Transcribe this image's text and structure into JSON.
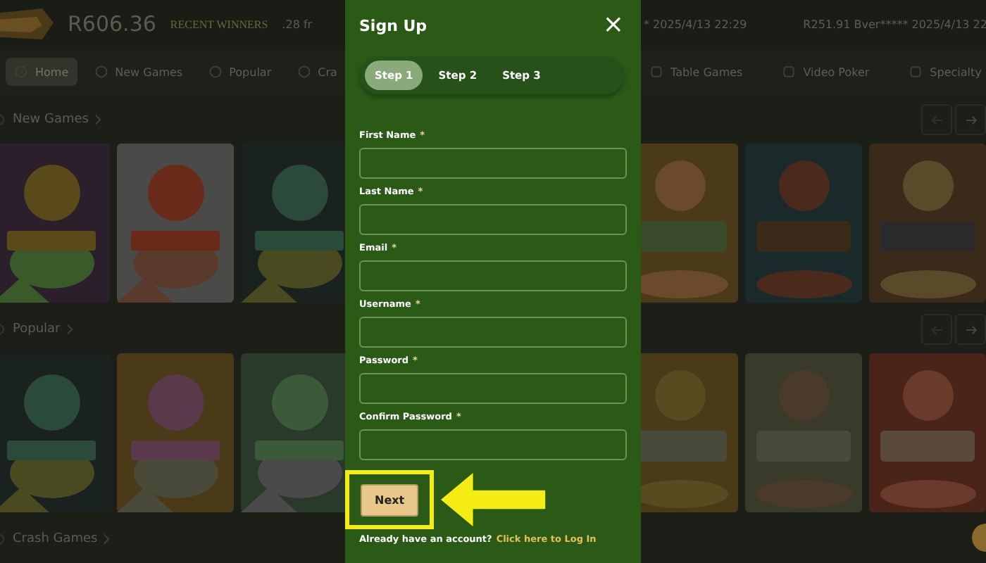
{
  "top_bar": {
    "balance": "R606.36",
    "winners_label": "RECENT WINNERS",
    "winner_left": ".28 fr",
    "winner_mid": "* 2025/4/13 22:29",
    "winner_right": "R251.91 Bver***** 2025/4/13 22"
  },
  "left_nav": [
    {
      "label": "Home",
      "selected": true
    },
    {
      "label": "New Games",
      "selected": false
    },
    {
      "label": "Popular",
      "selected": false
    },
    {
      "label": "Cra",
      "selected": false
    }
  ],
  "right_nav": [
    {
      "label": "Table Games",
      "selected": false
    },
    {
      "label": "Video Poker",
      "selected": false
    },
    {
      "label": "Specialty",
      "selected": false
    }
  ],
  "sections": [
    {
      "title": "New Games"
    },
    {
      "title": "Popular"
    },
    {
      "title": "Crash Games"
    }
  ],
  "modal": {
    "title": "Sign Up",
    "close": "×",
    "steps": [
      {
        "label": "Step 1",
        "selected": true
      },
      {
        "label": "Step 2",
        "selected": false
      },
      {
        "label": "Step 3",
        "selected": false
      }
    ],
    "fields": [
      {
        "label": "First Name",
        "required_mark": "*"
      },
      {
        "label": "Last Name",
        "required_mark": "*"
      },
      {
        "label": "Email",
        "required_mark": "*"
      },
      {
        "label": "Username",
        "required_mark": "*"
      },
      {
        "label": "Password",
        "required_mark": "*"
      },
      {
        "label": "Confirm Password",
        "required_mark": "*"
      }
    ],
    "next_button": "Next",
    "highlighted": true,
    "footer_text": "Already have an account?",
    "login_link": "Click here to Log In"
  }
}
